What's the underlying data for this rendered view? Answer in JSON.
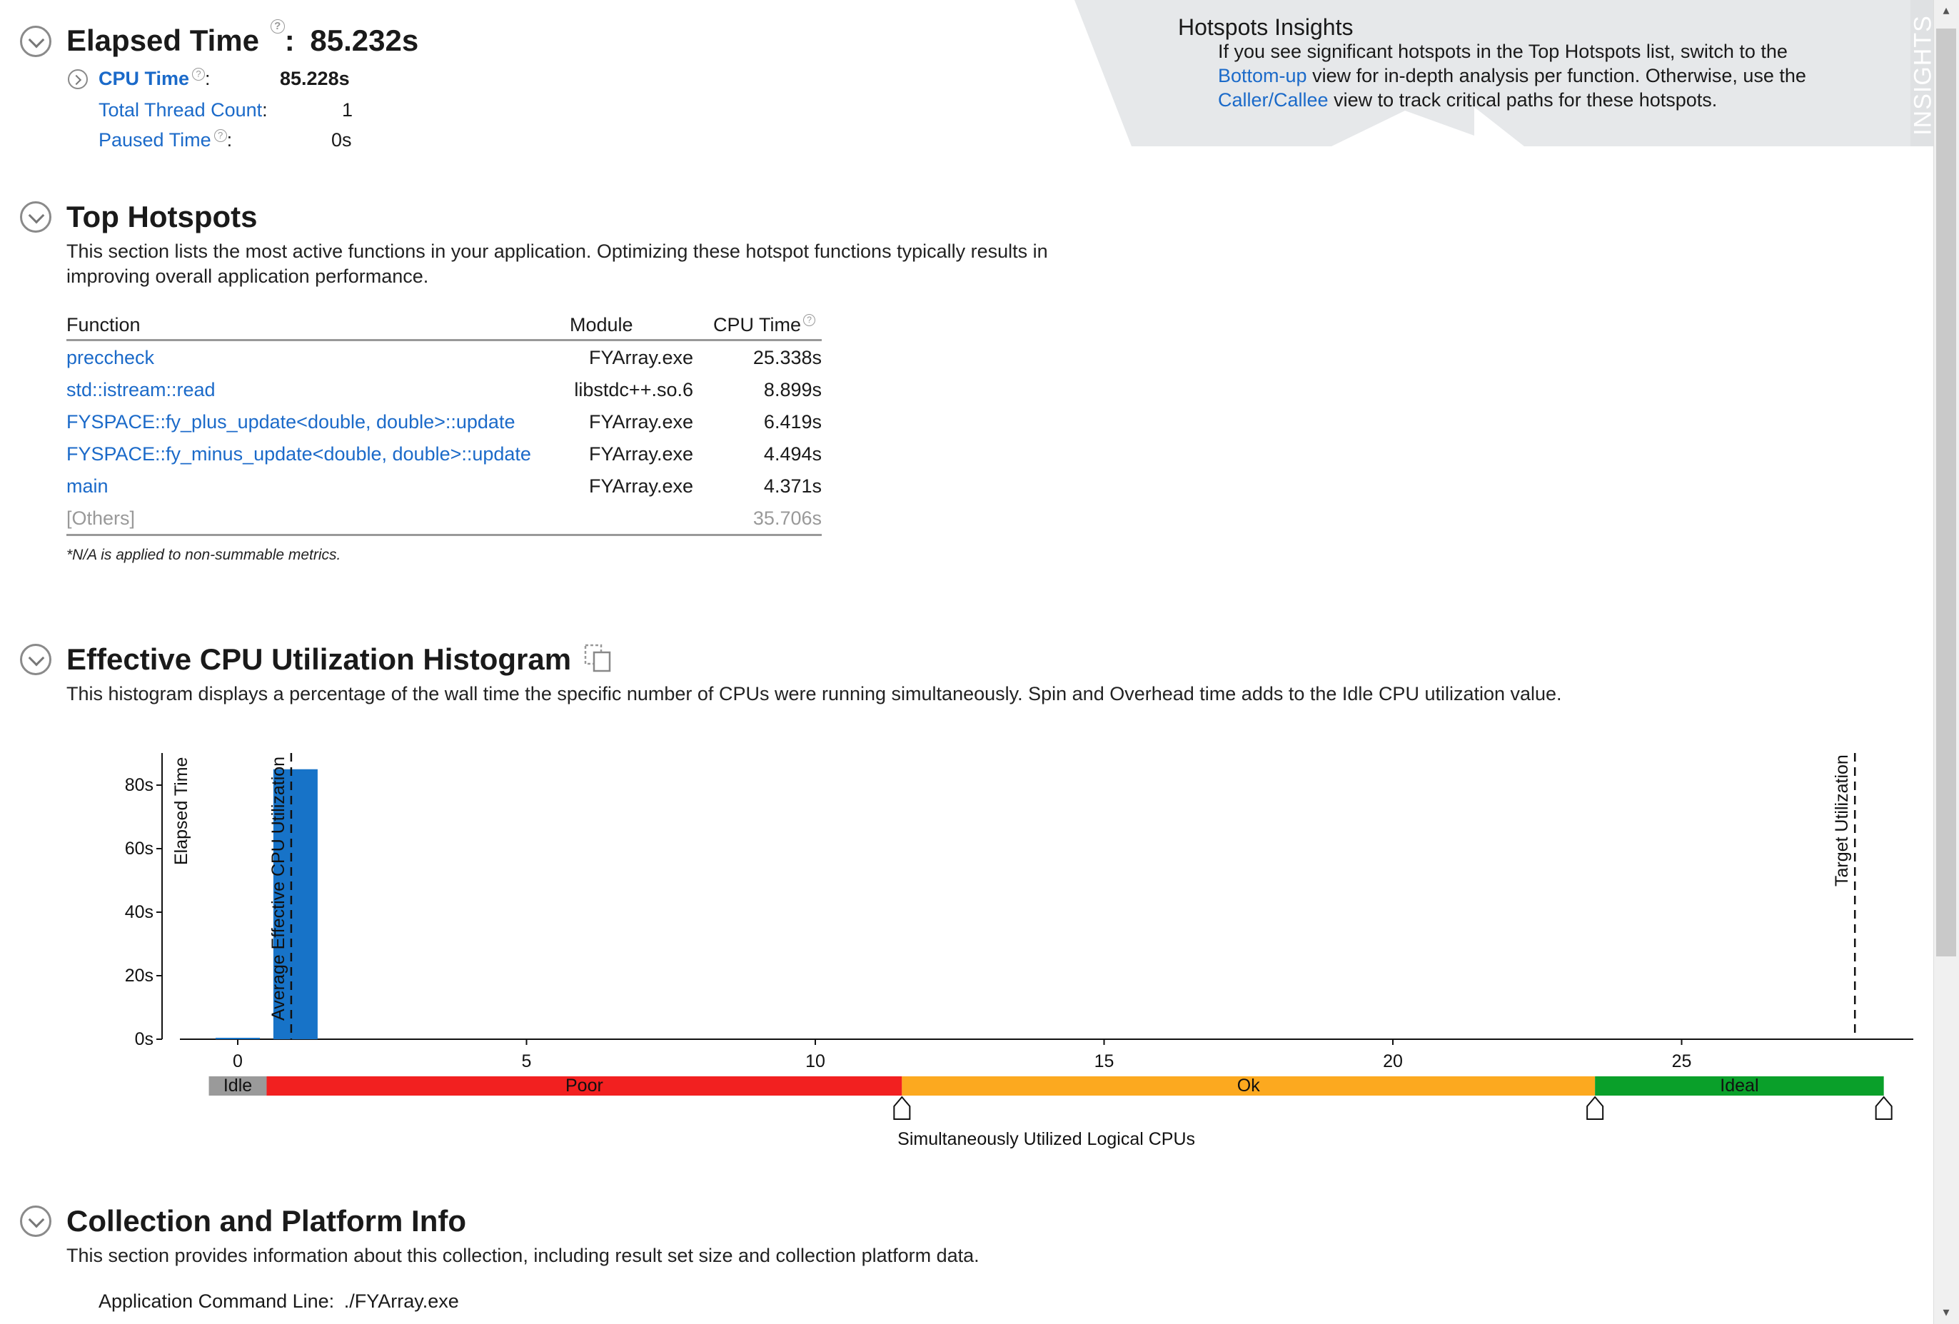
{
  "elapsed": {
    "label": "Elapsed Time",
    "separator": ":",
    "value": "85.232s",
    "help": "?",
    "metrics": [
      {
        "label": "CPU Time",
        "suffix": ":",
        "value": "85.228s",
        "help": "?"
      },
      {
        "label": "Total Thread Count",
        "suffix": ":",
        "value": "1"
      },
      {
        "label": "Paused Time",
        "suffix": ":",
        "value": "0s",
        "help": "?"
      }
    ]
  },
  "insights": {
    "title": "Hotspots Insights",
    "line1": "If you see significant hotspots in the Top Hotspots list, switch to the",
    "link1": "Bottom-up",
    "line2": " view for in-depth analysis per function. Otherwise, use the",
    "link2": "Caller/Callee",
    "line3": " view to track critical paths for these hotspots.",
    "tab_label": "INSIGHTS"
  },
  "top_hotspots": {
    "title": "Top Hotspots",
    "description": "This section lists the most active functions in your application. Optimizing these hotspot functions typically results in improving overall application performance.",
    "columns": {
      "function": "Function",
      "module": "Module",
      "cpu_time": "CPU Time",
      "help": "?"
    },
    "rows": [
      {
        "function": "preccheck",
        "module": "FYArray.exe",
        "cpu_time": "25.338s"
      },
      {
        "function": "std::istream::read",
        "module": "libstdc++.so.6",
        "cpu_time": "8.899s"
      },
      {
        "function": "FYSPACE::fy_plus_update<double, double>::update",
        "module": "FYArray.exe",
        "cpu_time": "6.419s"
      },
      {
        "function": "FYSPACE::fy_minus_update<double, double>::update",
        "module": "FYArray.exe",
        "cpu_time": "4.494s"
      },
      {
        "function": "main",
        "module": "FYArray.exe",
        "cpu_time": "4.371s"
      }
    ],
    "others": {
      "function": "[Others]",
      "cpu_time": "35.706s"
    },
    "footnote": "*N/A is applied to non-summable metrics."
  },
  "histogram": {
    "title": "Effective CPU Utilization Histogram",
    "description": "This histogram displays a percentage of the wall time the specific number of CPUs were running simultaneously. Spin and Overhead time adds to the Idle CPU utilization value."
  },
  "chart_data": {
    "type": "bar",
    "xlabel": "Simultaneously Utilized Logical CPUs",
    "ylabel": "Elapsed Time",
    "x_ticks": [
      0,
      5,
      10,
      15,
      20,
      25
    ],
    "y_ticks": [
      "0s",
      "20s",
      "40s",
      "60s",
      "80s"
    ],
    "ylim": [
      0,
      90
    ],
    "xlim": [
      -1,
      29
    ],
    "bars": [
      {
        "x": 0,
        "value": 0.4
      },
      {
        "x": 1,
        "value": 85
      }
    ],
    "markers": [
      {
        "label": "Average Effective CPU Utilization",
        "x": 1
      },
      {
        "label": "Target Utilization",
        "x": 28
      }
    ],
    "bands": [
      {
        "label": "Idle",
        "from": -0.5,
        "to": 0.5,
        "color": "#9a9a9a"
      },
      {
        "label": "Poor",
        "from": 0.5,
        "to": 11.5,
        "color": "#f22020"
      },
      {
        "label": "Ok",
        "from": 11.5,
        "to": 23.5,
        "color": "#fca91f"
      },
      {
        "label": "Ideal",
        "from": 23.5,
        "to": 28.5,
        "color": "#0aa02a"
      }
    ],
    "colors": {
      "bar": "#1773c8"
    }
  },
  "collection": {
    "title": "Collection and Platform Info",
    "description": "This section provides information about this collection, including result set size and collection platform data.",
    "command_label": "Application Command Line:",
    "command_value": "./FYArray.exe"
  }
}
